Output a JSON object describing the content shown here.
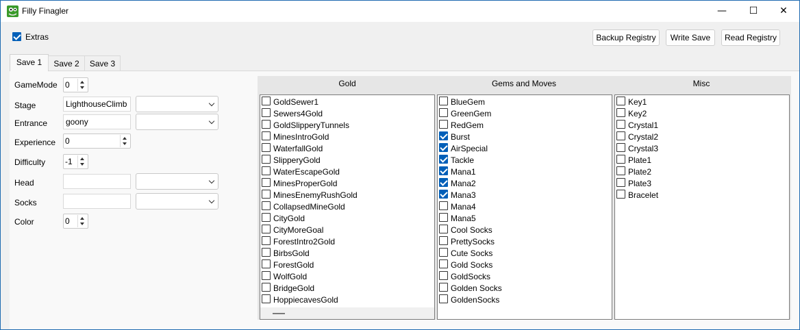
{
  "window": {
    "title": "Filly Finagler",
    "minimize": "—",
    "maximize": "☐",
    "close": "✕"
  },
  "extras": {
    "label": "Extras",
    "checked": true
  },
  "buttons": {
    "backup": "Backup Registry",
    "write": "Write Save",
    "read": "Read Registry"
  },
  "tabs": [
    "Save 1",
    "Save 2",
    "Save 3"
  ],
  "fields": {
    "gamemode": {
      "label": "GameMode",
      "value": "0"
    },
    "stage": {
      "label": "Stage",
      "value": "LighthouseClimb"
    },
    "entrance": {
      "label": "Entrance",
      "value": "goony"
    },
    "experience": {
      "label": "Experience",
      "value": "0"
    },
    "difficulty": {
      "label": "Difficulty",
      "value": "-1"
    },
    "head": {
      "label": "Head",
      "value": ""
    },
    "socks": {
      "label": "Socks",
      "value": ""
    },
    "color": {
      "label": "Color",
      "value": "0"
    }
  },
  "groups": {
    "gold": {
      "header": "Gold",
      "items": [
        {
          "label": "GoldSewer1",
          "checked": false
        },
        {
          "label": "Sewers4Gold",
          "checked": false
        },
        {
          "label": "GoldSlipperyTunnels",
          "checked": false
        },
        {
          "label": "MinesIntroGold",
          "checked": false
        },
        {
          "label": "WaterfallGold",
          "checked": false
        },
        {
          "label": "SlipperyGold",
          "checked": false
        },
        {
          "label": "WaterEscapeGold",
          "checked": false
        },
        {
          "label": "MinesProperGold",
          "checked": false
        },
        {
          "label": "MinesEnemyRushGold",
          "checked": false
        },
        {
          "label": "CollapsedMineGold",
          "checked": false
        },
        {
          "label": "CityGold",
          "checked": false
        },
        {
          "label": "CityMoreGoal",
          "checked": false
        },
        {
          "label": "ForestIntro2Gold",
          "checked": false
        },
        {
          "label": "BirbsGold",
          "checked": false
        },
        {
          "label": "ForestGold",
          "checked": false
        },
        {
          "label": "WolfGold",
          "checked": false
        },
        {
          "label": "BridgeGold",
          "checked": false
        },
        {
          "label": "HoppiecavesGold",
          "checked": false
        }
      ]
    },
    "gems": {
      "header": "Gems and Moves",
      "items": [
        {
          "label": "BlueGem",
          "checked": false
        },
        {
          "label": "GreenGem",
          "checked": false
        },
        {
          "label": "RedGem",
          "checked": false
        },
        {
          "label": "Burst",
          "checked": true
        },
        {
          "label": "AirSpecial",
          "checked": true
        },
        {
          "label": "Tackle",
          "checked": true
        },
        {
          "label": "Mana1",
          "checked": true
        },
        {
          "label": "Mana2",
          "checked": true
        },
        {
          "label": "Mana3",
          "checked": true
        },
        {
          "label": "Mana4",
          "checked": false
        },
        {
          "label": "Mana5",
          "checked": false
        },
        {
          "label": "Cool Socks",
          "checked": false
        },
        {
          "label": "PrettySocks",
          "checked": false
        },
        {
          "label": "Cute Socks",
          "checked": false
        },
        {
          "label": "Gold Socks",
          "checked": false
        },
        {
          "label": "GoldSocks",
          "checked": false
        },
        {
          "label": "Golden Socks",
          "checked": false
        },
        {
          "label": "GoldenSocks",
          "checked": false
        }
      ]
    },
    "misc": {
      "header": "Misc",
      "items": [
        {
          "label": "Key1",
          "checked": false
        },
        {
          "label": "Key2",
          "checked": false
        },
        {
          "label": "Crystal1",
          "checked": false
        },
        {
          "label": "Crystal2",
          "checked": false
        },
        {
          "label": "Crystal3",
          "checked": false
        },
        {
          "label": "Plate1",
          "checked": false
        },
        {
          "label": "Plate2",
          "checked": false
        },
        {
          "label": "Plate3",
          "checked": false
        },
        {
          "label": "Bracelet",
          "checked": false
        }
      ]
    }
  }
}
